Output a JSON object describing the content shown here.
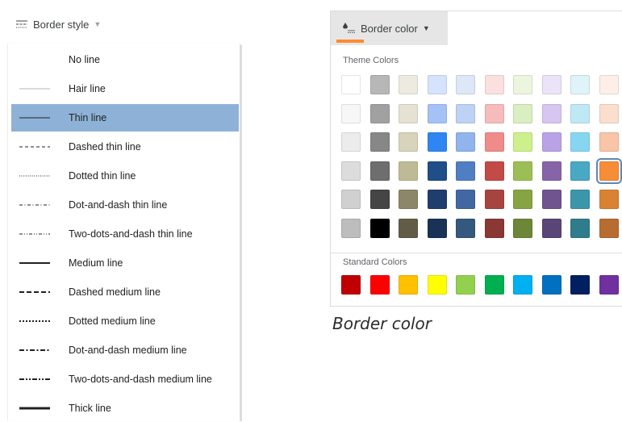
{
  "border_style": {
    "button_label": "Border style",
    "icon": "border-style-icon",
    "items": [
      {
        "label": "No line",
        "style": "none"
      },
      {
        "label": "Hair line",
        "style": "hair"
      },
      {
        "label": "Thin line",
        "style": "thin",
        "selected": true
      },
      {
        "label": "Dashed thin line",
        "style": "dashed-thin"
      },
      {
        "label": "Dotted thin line",
        "style": "dotted-thin"
      },
      {
        "label": "Dot-and-dash thin line",
        "style": "dotdash-thin"
      },
      {
        "label": "Two-dots-and-dash thin line",
        "style": "twodots-thin"
      },
      {
        "label": "Medium line",
        "style": "medium"
      },
      {
        "label": "Dashed medium line",
        "style": "dashed-medium"
      },
      {
        "label": "Dotted medium line",
        "style": "dotted-medium"
      },
      {
        "label": "Dot-and-dash medium line",
        "style": "dotdash-medium"
      },
      {
        "label": "Two-dots-and-dash medium line",
        "style": "twodots-medium"
      },
      {
        "label": "Thick line",
        "style": "thick"
      }
    ],
    "selected_color": "#8eb2d7"
  },
  "border_color": {
    "button_label": "Border color",
    "icon": "paint-bucket-border-icon",
    "accent": "#ff8b2e",
    "theme_label": "Theme Colors",
    "standard_label": "Standard Colors",
    "theme_rows": [
      [
        "#ffffff",
        "#b7b7b7",
        "#edebe0",
        "#d6e3fc",
        "#dde7f7",
        "#fbe0e0",
        "#ecf6df",
        "#ebe3f8",
        "#def3fa",
        "#fdefe7"
      ],
      [
        "#f7f7f7",
        "#a1a1a1",
        "#e5e2d3",
        "#a5c2f7",
        "#bed2f4",
        "#f6bcbb",
        "#d9efc1",
        "#d6c6f1",
        "#bfe8f5",
        "#fbdecd"
      ],
      [
        "#ececec",
        "#878787",
        "#d8d3bb",
        "#2f86f2",
        "#8fb5ec",
        "#ef8c8a",
        "#cdf08d",
        "#b9a3e6",
        "#87d6f1",
        "#f9c4a7"
      ],
      [
        "#dcdcdc",
        "#6e6e6e",
        "#bfba96",
        "#204e86",
        "#4f7fc3",
        "#c24b47",
        "#9bbf56",
        "#8764a8",
        "#49a8c3",
        "#f68e38"
      ],
      [
        "#d0d0d0",
        "#454545",
        "#8b8768",
        "#1f3d6d",
        "#4168a2",
        "#a84440",
        "#87a443",
        "#6f548f",
        "#3b96aa",
        "#d98233"
      ],
      [
        "#bdbdbd",
        "#000000",
        "#605c46",
        "#183356",
        "#34587e",
        "#8a3834",
        "#6d8637",
        "#5a4577",
        "#2f7c8c",
        "#b86d30"
      ]
    ],
    "standard_row": [
      "#c00000",
      "#ff0000",
      "#ffc000",
      "#ffff00",
      "#92d050",
      "#00b050",
      "#00b0f0",
      "#0070c0",
      "#002060",
      "#7030a0"
    ],
    "selected": "row 4, column 10"
  },
  "caption": "Border color"
}
